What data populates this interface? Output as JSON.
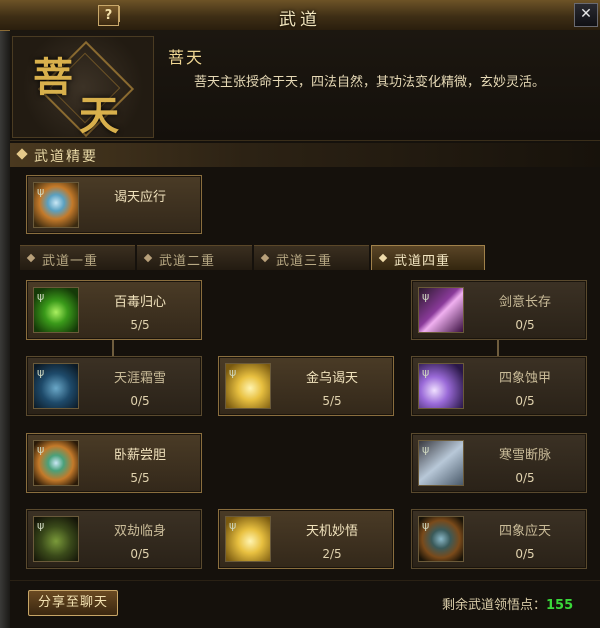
{
  "window": {
    "title": "武道",
    "help": "?",
    "close": "✕"
  },
  "header": {
    "emblem_char1": "菩",
    "emblem_char2": "天",
    "name": "菩天",
    "description": "菩天主张授命于天，四法自然，其功法变化精微，玄妙灵活。"
  },
  "section": {
    "title": "武道精要"
  },
  "essential": {
    "name": "谒天应行"
  },
  "tabs": [
    {
      "label": "武道一重"
    },
    {
      "label": "武道二重"
    },
    {
      "label": "武道三重"
    },
    {
      "label": "武道四重"
    }
  ],
  "skills": {
    "baidu": {
      "name": "百毒归心",
      "count": "5/5"
    },
    "jianyi": {
      "name": "剑意长存",
      "count": "0/5"
    },
    "tianya": {
      "name": "天涯霜雪",
      "count": "0/5"
    },
    "jinwu": {
      "name": "金乌谒天",
      "count": "5/5"
    },
    "sixiang": {
      "name": "四象蚀甲",
      "count": "0/5"
    },
    "woxin": {
      "name": "卧薪尝胆",
      "count": "5/5"
    },
    "hanxue": {
      "name": "寒雪断脉",
      "count": "0/5"
    },
    "shuangjie": {
      "name": "双劫临身",
      "count": "0/5"
    },
    "tianji": {
      "name": "天机妙悟",
      "count": "2/5"
    },
    "sixiangying": {
      "name": "四象应天",
      "count": "0/5"
    }
  },
  "footer": {
    "share_label": "分享至聊天",
    "points_label": "剩余武道领悟点：",
    "points_value": "155"
  },
  "colors": {
    "accent": "#d8b04c",
    "points": "#3ad83a",
    "active_border": "#a0814a"
  }
}
